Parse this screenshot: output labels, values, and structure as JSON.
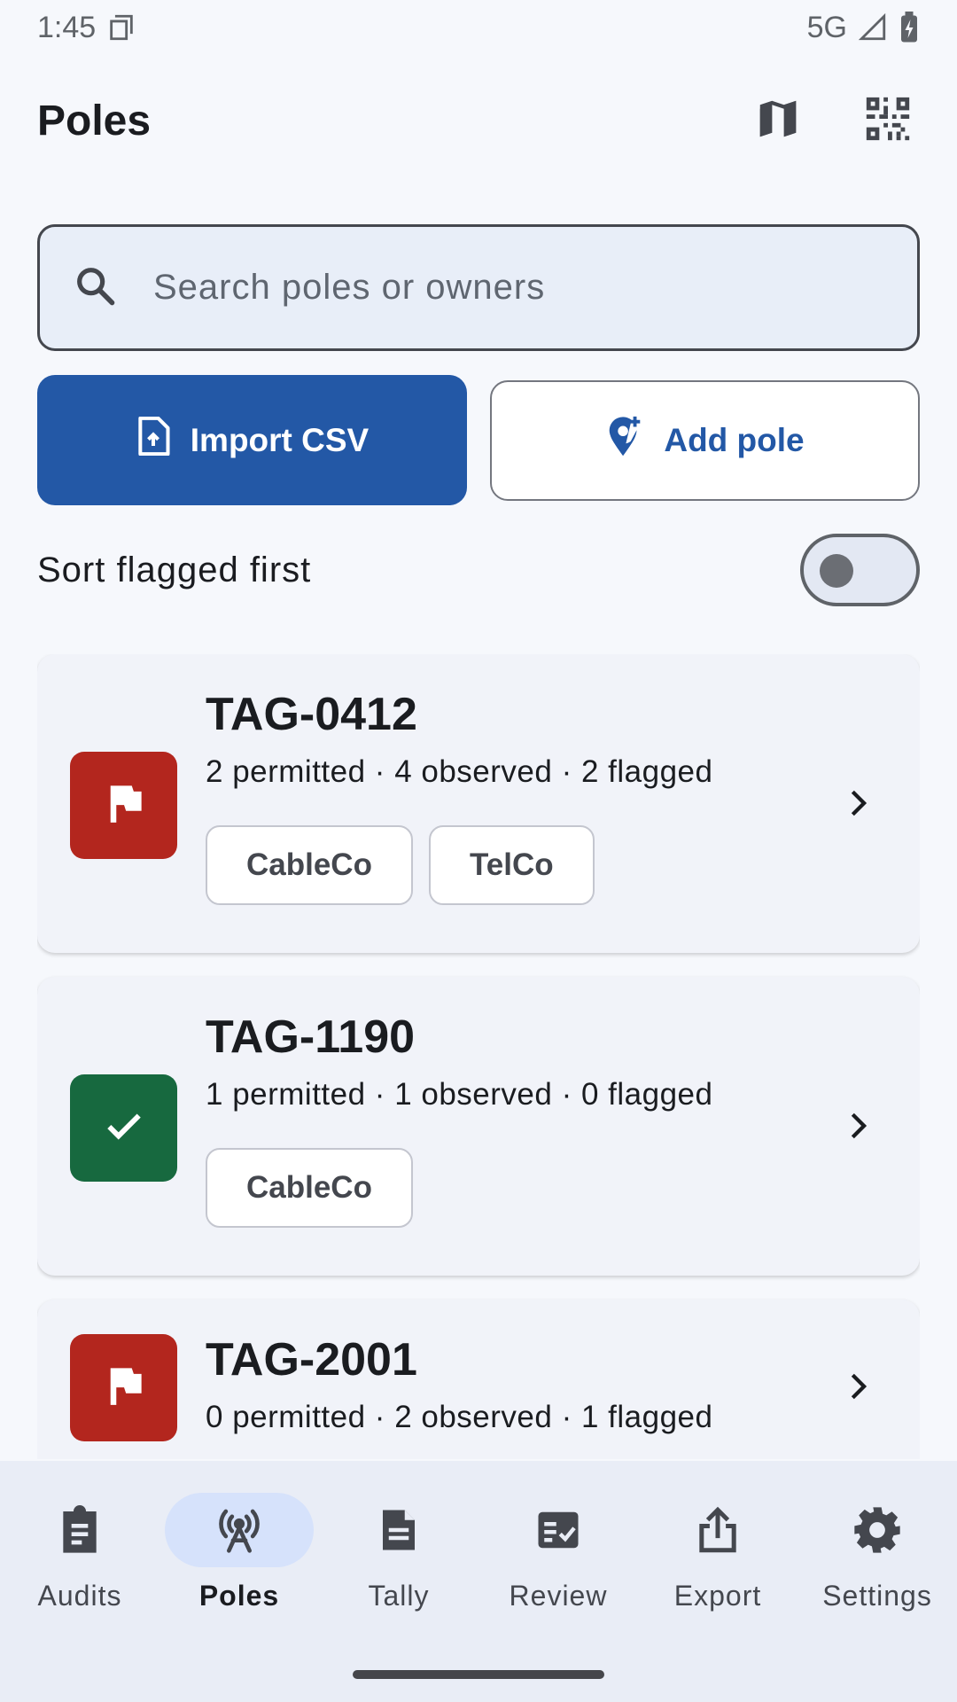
{
  "status_bar": {
    "time": "1:45",
    "network": "5G"
  },
  "app_bar": {
    "title": "Poles",
    "actions": [
      "map-icon",
      "qr-code-scanner-icon"
    ]
  },
  "search": {
    "placeholder": "Search poles or owners",
    "value": ""
  },
  "actions": {
    "import_label": "Import CSV",
    "add_label": "Add pole"
  },
  "sort": {
    "label": "Sort flagged first",
    "enabled": false
  },
  "colors": {
    "primary": "#2358a6",
    "flagged": "#b3261e",
    "ok": "#17693f"
  },
  "poles": [
    {
      "id": "TAG-0412",
      "stats": "2 permitted · 4 observed · 2 flagged",
      "status": "flagged",
      "owners": [
        "CableCo",
        "TelCo"
      ]
    },
    {
      "id": "TAG-1190",
      "stats": "1 permitted · 1 observed · 0 flagged",
      "status": "ok",
      "owners": [
        "CableCo"
      ]
    },
    {
      "id": "TAG-2001",
      "stats": "0 permitted · 2 observed · 1 flagged",
      "status": "flagged",
      "owners": []
    }
  ],
  "nav": {
    "active": "Poles",
    "items": [
      {
        "label": "Audits",
        "icon": "clipboard-icon"
      },
      {
        "label": "Poles",
        "icon": "antenna-tower-icon"
      },
      {
        "label": "Tally",
        "icon": "note-icon"
      },
      {
        "label": "Review",
        "icon": "checklist-icon"
      },
      {
        "label": "Export",
        "icon": "share-icon"
      },
      {
        "label": "Settings",
        "icon": "gear-icon"
      }
    ]
  }
}
